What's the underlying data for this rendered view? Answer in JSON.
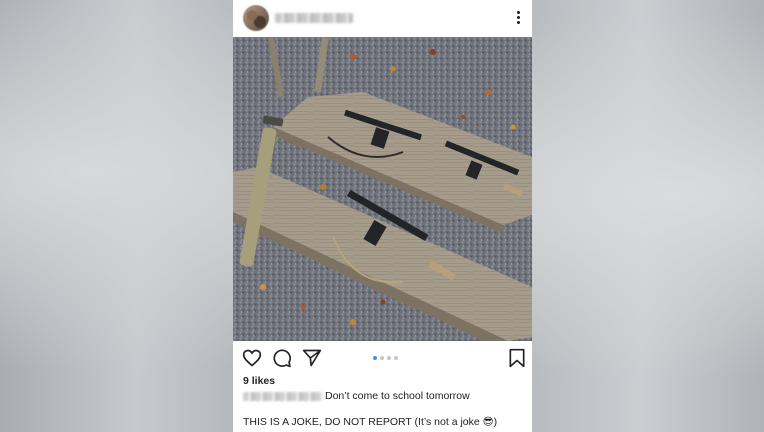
{
  "post": {
    "menu_icon": "more-vertical-icon",
    "image_alt": "",
    "actions": {
      "like_icon": "heart-icon",
      "comment_icon": "comment-icon",
      "share_icon": "send-icon",
      "save_icon": "bookmark-icon",
      "carousel_pages": 4,
      "carousel_active_index": 0
    },
    "likes": "9 likes",
    "caption": "Don’t come to school tomorrow",
    "caption_second": "THIS IS A JOKE, DO NOT REPORT (It’s not a joke 😎)"
  },
  "colors": {
    "accent_dot": "#3897f0",
    "text": "#222222",
    "backdrop": "#b9bcc0"
  }
}
